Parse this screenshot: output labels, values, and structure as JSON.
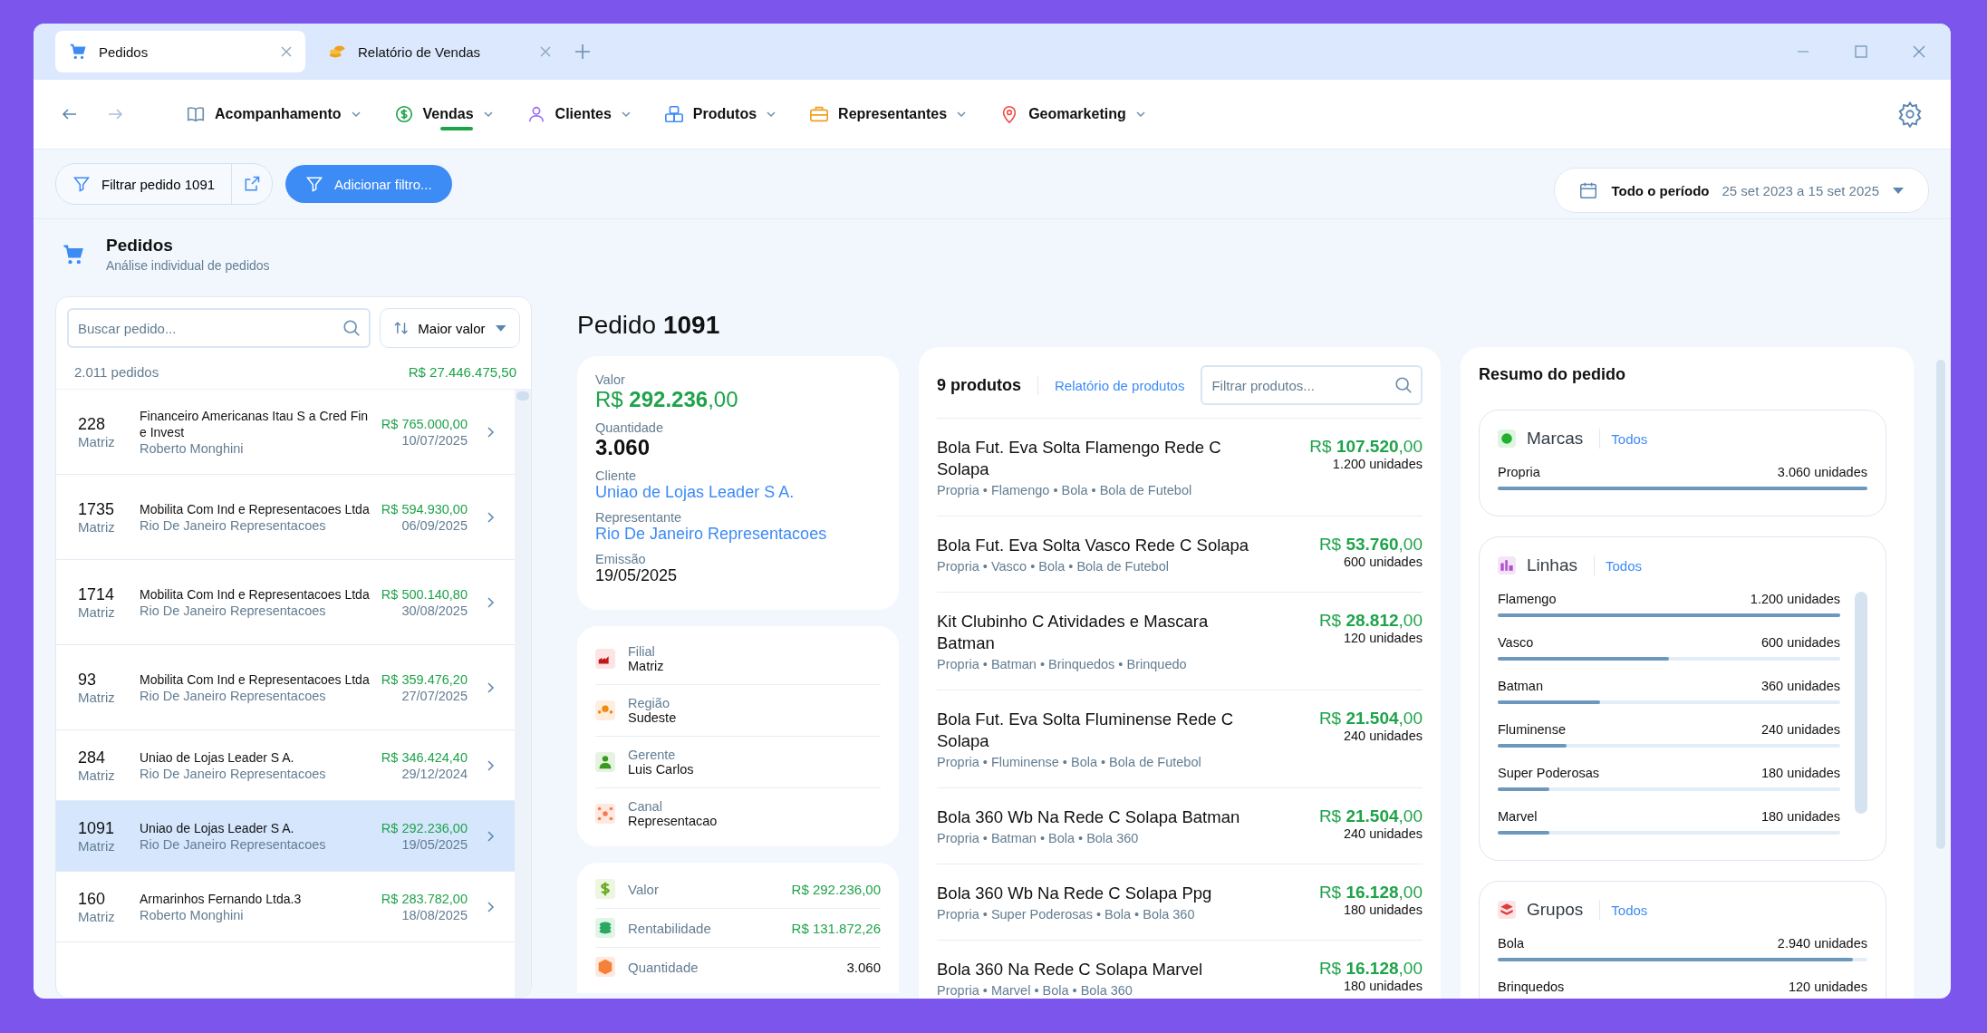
{
  "tabs": [
    {
      "label": "Pedidos",
      "kind": "cart",
      "selected": true
    },
    {
      "label": "Relatório de Vendas",
      "kind": "coins",
      "selected": false
    }
  ],
  "nav": [
    {
      "label": "Acompanhamento",
      "kind": "book",
      "selected": false
    },
    {
      "label": "Vendas",
      "kind": "dollar",
      "selected": true
    },
    {
      "label": "Clientes",
      "kind": "person",
      "selected": false
    },
    {
      "label": "Produtos",
      "kind": "boxes",
      "selected": false
    },
    {
      "label": "Representantes",
      "kind": "briefcase",
      "selected": false
    },
    {
      "label": "Geomarketing",
      "kind": "pin",
      "selected": false
    }
  ],
  "filters": {
    "filter_chip": "Filtrar pedido 1091",
    "add_button": "Adicionar filtro..."
  },
  "period": {
    "label": "Todo o período",
    "range": "25 set 2023 a 15 set 2025"
  },
  "page": {
    "title": "Pedidos",
    "subtitle": "Análise individual de pedidos"
  },
  "orders": {
    "search_placeholder": "Buscar pedido...",
    "sort": "Maior valor",
    "count": "2.011 pedidos",
    "total": "R$ 27.446.475,50",
    "rows": [
      {
        "number": "228",
        "branch": "Matriz",
        "client": "Financeiro Americanas Itau S a Cred Fin e Invest",
        "rep": "Roberto Monghini",
        "value": "R$ 765.000,00",
        "date": "10/07/2025",
        "selected": false
      },
      {
        "number": "1735",
        "branch": "Matriz",
        "client": "Mobilita Com Ind e Representacoes Ltda",
        "rep": "Rio De Janeiro Representacoes",
        "value": "R$ 594.930,00",
        "date": "06/09/2025",
        "selected": false
      },
      {
        "number": "1714",
        "branch": "Matriz",
        "client": "Mobilita Com Ind e Representacoes Ltda",
        "rep": "Rio De Janeiro Representacoes",
        "value": "R$ 500.140,80",
        "date": "30/08/2025",
        "selected": false
      },
      {
        "number": "93",
        "branch": "Matriz",
        "client": "Mobilita Com Ind e Representacoes Ltda",
        "rep": "Rio De Janeiro Representacoes",
        "value": "R$ 359.476,20",
        "date": "27/07/2025",
        "selected": false
      },
      {
        "number": "284",
        "branch": "Matriz",
        "client": "Uniao de Lojas Leader S A.",
        "rep": "Rio De Janeiro Representacoes",
        "value": "R$ 346.424,40",
        "date": "29/12/2024",
        "selected": false
      },
      {
        "number": "1091",
        "branch": "Matriz",
        "client": "Uniao de Lojas Leader S A.",
        "rep": "Rio De Janeiro Representacoes",
        "value": "R$ 292.236,00",
        "date": "19/05/2025",
        "selected": true
      },
      {
        "number": "160",
        "branch": "Matriz",
        "client": "Armarinhos Fernando Ltda.3",
        "rep": "Roberto Monghini",
        "value": "R$ 283.782,00",
        "date": "18/08/2025",
        "selected": false
      }
    ]
  },
  "order": {
    "title": "Pedido **1091**",
    "fields": [
      {
        "label": "Valor",
        "value": "R$ **292.236**,00",
        "kind": "money"
      },
      {
        "label": "Quantidade",
        "value": "3.060",
        "kind": "big"
      },
      {
        "label": "Cliente",
        "value": "Uniao de Lojas Leader S A.",
        "kind": "link"
      },
      {
        "label": "Representante",
        "value": "Rio De Janeiro Representacoes",
        "kind": "link"
      },
      {
        "label": "Emissão",
        "value": "19/05/2025",
        "kind": "plain"
      }
    ],
    "info": [
      {
        "label": "Filial",
        "value": "Matriz",
        "kind": "factory"
      },
      {
        "label": "Região",
        "value": "Sudeste",
        "kind": "region"
      },
      {
        "label": "Gerente",
        "value": "Luis Carlos",
        "kind": "manager"
      },
      {
        "label": "Canal",
        "value": "Representacao",
        "kind": "network"
      }
    ],
    "totals": [
      {
        "label": "Valor",
        "value": "R$ 292.236,00",
        "kind": "value"
      },
      {
        "label": "Rentabilidade",
        "value": "R$ 131.872,26",
        "kind": "profit"
      },
      {
        "label": "Quantidade",
        "value": "3.060",
        "kind": "quantity"
      }
    ]
  },
  "products": {
    "count": "9 produtos",
    "report_link": "Relatório de produtos",
    "filter_placeholder": "Filtrar produtos...",
    "items": [
      {
        "name": "Bola Fut. Eva Solta Flamengo Rede C Solapa",
        "tags": "Propria • Flamengo • Bola • Bola de Futebol",
        "value": "R$ **107.520**,00",
        "units": "1.200 unidades"
      },
      {
        "name": "Bola Fut. Eva Solta Vasco Rede C  Solapa",
        "tags": "Propria • Vasco • Bola • Bola de Futebol",
        "value": "R$ **53.760**,00",
        "units": "600 unidades"
      },
      {
        "name": "Kit Clubinho C  Atividades e Mascara Batman",
        "tags": "Propria • Batman • Brinquedos • Brinquedo",
        "value": "R$ **28.812**,00",
        "units": "120 unidades"
      },
      {
        "name": "Bola Fut. Eva Solta Fluminense Rede C Solapa",
        "tags": "Propria • Fluminense • Bola • Bola de Futebol",
        "value": "R$ **21.504**,00",
        "units": "240 unidades"
      },
      {
        "name": "Bola 360 Wb Na Rede C  Solapa Batman",
        "tags": "Propria • Batman • Bola • Bola 360",
        "value": "R$ **21.504**,00",
        "units": "240 unidades"
      },
      {
        "name": "Bola 360 Wb Na Rede C  Solapa Ppg",
        "tags": "Propria • Super Poderosas • Bola • Bola 360",
        "value": "R$ **16.128**,00",
        "units": "180 unidades"
      },
      {
        "name": "Bola 360  Na Rede C  Solapa Marvel",
        "tags": "Propria • Marvel • Bola • Bola 360",
        "value": "R$ **16.128**,00",
        "units": "180 unidades"
      }
    ]
  },
  "summary": {
    "title": "Resumo do pedido",
    "groups": [
      {
        "title": "Marcas",
        "kind": "brands",
        "link": "Todos",
        "items": [
          {
            "label": "Propria",
            "units": "3.060 unidades",
            "level": 1
          }
        ]
      },
      {
        "title": "Linhas",
        "kind": "lines",
        "link": "Todos",
        "items": [
          {
            "label": "Flamengo",
            "units": "1.200 unidades",
            "level": 1
          },
          {
            "label": "Vasco",
            "units": "600 unidades",
            "level": 0.5
          },
          {
            "label": "Batman",
            "units": "360 unidades",
            "level": 0.3
          },
          {
            "label": "Fluminense",
            "units": "240 unidades",
            "level": 0.2
          },
          {
            "label": "Super Poderosas",
            "units": "180 unidades",
            "level": 0.15
          },
          {
            "label": "Marvel",
            "units": "180 unidades",
            "level": 0.15
          }
        ]
      },
      {
        "title": "Grupos",
        "kind": "groups",
        "link": "Todos",
        "items": [
          {
            "label": "Bola",
            "units": "2.940 unidades",
            "level": 0.96
          },
          {
            "label": "Brinquedos",
            "units": "120 unidades"
          }
        ]
      }
    ]
  }
}
